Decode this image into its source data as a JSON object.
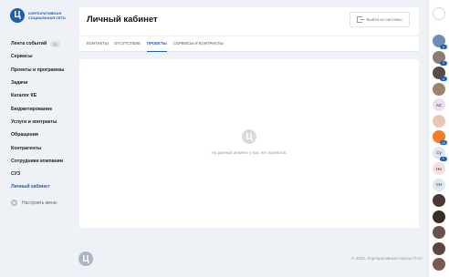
{
  "brand": {
    "logo_letter": "Ц",
    "name": "КОРПОРАТИВНАЯ СОЦИАЛЬНАЯ СЕТЬ"
  },
  "sidebar": {
    "items": [
      {
        "label": "Лента событий",
        "badge": "12"
      },
      {
        "label": "Сервисы"
      },
      {
        "label": "Проекты и программы"
      },
      {
        "label": "Задачи"
      },
      {
        "label": "Каталог КЕ"
      },
      {
        "label": "Бюджетирование"
      },
      {
        "label": "Услуги и контракты"
      },
      {
        "label": "Обращения"
      },
      {
        "label": "Контрагенты"
      },
      {
        "label": "Сотрудники компании"
      },
      {
        "label": "СУЗ"
      },
      {
        "label": "Личный кабинет",
        "active": true
      }
    ],
    "settings_label": "Настроить меню"
  },
  "header": {
    "title": "Личный кабинет",
    "logout_label": "Выйти из системы"
  },
  "tabs": [
    {
      "label": "Контакты"
    },
    {
      "label": "Отсутствие"
    },
    {
      "label": "Проекты",
      "active": true
    },
    {
      "label": "Сервисы и контракты"
    }
  ],
  "content": {
    "empty_message": "На данный момент у вас нет проектов."
  },
  "footer": {
    "copyright": "© 2020, Корпоративный портал ПАО"
  },
  "rail": {
    "avatars": [
      {
        "color": "#6c8fb8",
        "text": "",
        "badge": "2"
      },
      {
        "color": "#8a7d6e",
        "text": "",
        "badge": "2"
      },
      {
        "color": "#5a4a46",
        "text": "",
        "badge": "4"
      },
      {
        "color": "#a0836c",
        "text": "",
        "badge": ""
      },
      {
        "color": "#e8e0f0",
        "text": "АС",
        "badge": ""
      },
      {
        "color": "#e9c7b6",
        "text": "",
        "badge": ""
      },
      {
        "color": "#f47c24",
        "text": "",
        "badge": "10"
      },
      {
        "color": "#dfe7f5",
        "text": "Су",
        "badge": "1"
      },
      {
        "color": "#f6dede",
        "text": "Нн",
        "badge": ""
      },
      {
        "color": "#dbe8f3",
        "text": "СН",
        "badge": ""
      },
      {
        "color": "#4a3a36",
        "text": "",
        "badge": ""
      },
      {
        "color": "#3b2c2a",
        "text": "",
        "badge": ""
      },
      {
        "color": "#6b5248",
        "text": "",
        "badge": ""
      },
      {
        "color": "#5a463e",
        "text": "",
        "badge": ""
      },
      {
        "color": "#7a5d52",
        "text": "",
        "badge": ""
      }
    ]
  }
}
